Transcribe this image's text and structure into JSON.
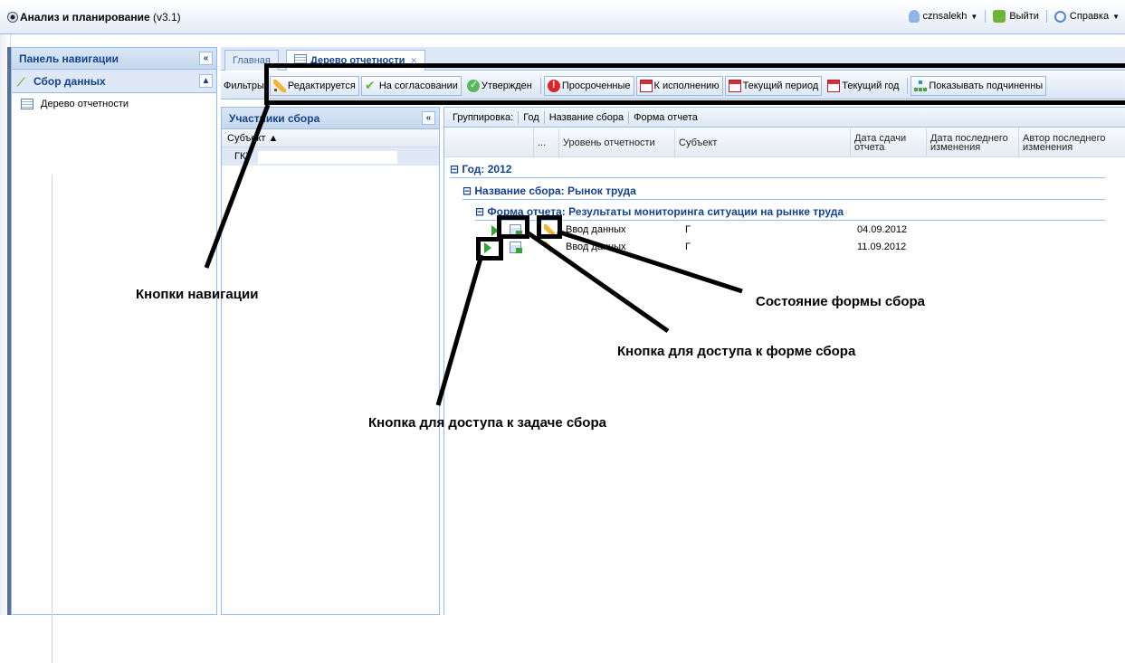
{
  "app": {
    "title": "Анализ и планирование",
    "version": "(v3.1)",
    "user": "cznsalekh",
    "logout": "Выйти",
    "help": "Справка"
  },
  "nav": {
    "panel_title": "Панель навигации",
    "group_title": "Сбор данных",
    "items": [
      {
        "label": "Дерево отчетности"
      }
    ]
  },
  "tabs": [
    {
      "label": "Главная",
      "active": false
    },
    {
      "label": "Дерево отчетности",
      "active": true
    }
  ],
  "toolbar": {
    "filters_label": "Фильтры:",
    "buttons": [
      {
        "label": "Редактируется",
        "icon": "pencil-icon"
      },
      {
        "label": "На согласовании",
        "icon": "check-icon"
      },
      {
        "label": "Утвержден",
        "icon": "ok-circle-icon"
      },
      {
        "label": "Просроченные",
        "icon": "alert-icon"
      },
      {
        "label": "К исполнению",
        "icon": "calendar-icon"
      },
      {
        "label": "Текущий период",
        "icon": "calendar-icon"
      },
      {
        "label": "Текущий год",
        "icon": "calendar-icon"
      },
      {
        "label": "Показывать подчиненны",
        "icon": "tree-icon"
      }
    ]
  },
  "participants": {
    "title": "Участники сбора",
    "column": "Субъект ▲",
    "row_text": "ГКУ"
  },
  "grid": {
    "grouping_label": "Группировка:",
    "grouping_items": [
      "Год",
      "Название сбора",
      "Форма отчета"
    ],
    "columns": [
      "...",
      "Уровень отчетности",
      "Субъект",
      "Дата сдачи отчета",
      "Дата последнего изменения",
      "Автор последнего изменения"
    ],
    "group_year": "Год: 2012",
    "group_name": "Название сбора: Рынок труда",
    "group_form": "Форма отчета: Результаты мониторинга ситуации на рынке труда",
    "rows": [
      {
        "level": "Ввод данных",
        "subject": "Г",
        "date": "04.09.2012"
      },
      {
        "level": "Ввод данных",
        "subject": "Г",
        "date": "11.09.2012"
      }
    ]
  },
  "annotations": {
    "nav_buttons": "Кнопки навигации",
    "form_state": "Состояние формы сбора",
    "form_access": "Кнопка для доступа к форме сбора",
    "task_access": "Кнопка для доступа к задаче сбора"
  }
}
